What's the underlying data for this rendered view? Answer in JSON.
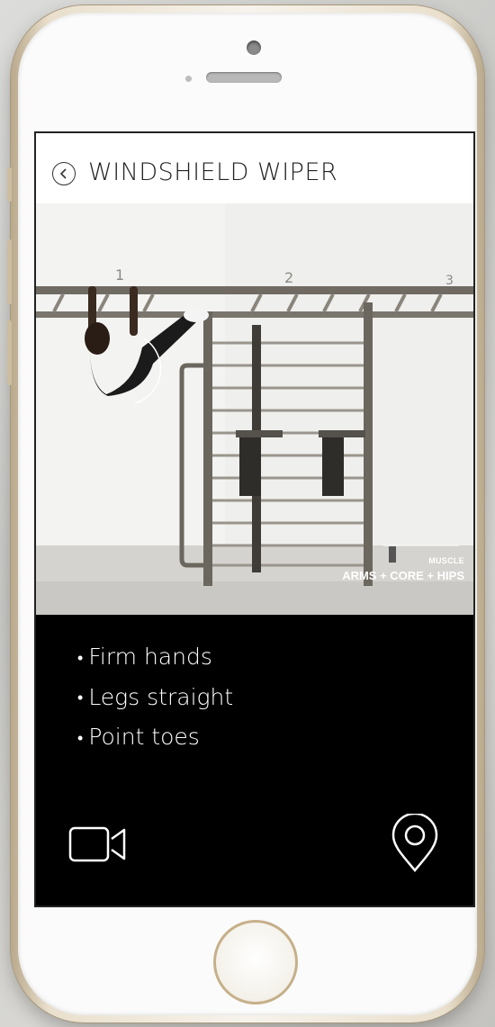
{
  "screen": {
    "title": "WINDSHIELD WIPER",
    "back_icon": "chevron-left-circle-icon"
  },
  "photo": {
    "bar_numbers": [
      "1",
      "2",
      "3"
    ],
    "muscle_label": "MUSCLE",
    "muscle_value": "ARMS + CORE + HIPS"
  },
  "tips": [
    "Firm hands",
    "Legs straight",
    "Point toes"
  ],
  "actions": {
    "video_icon": "video-camera-icon",
    "map_icon": "location-pin-icon"
  },
  "colors": {
    "accent_gold": "#c6b08a",
    "screen_bg": "#000000",
    "header_bg": "#ffffff"
  }
}
